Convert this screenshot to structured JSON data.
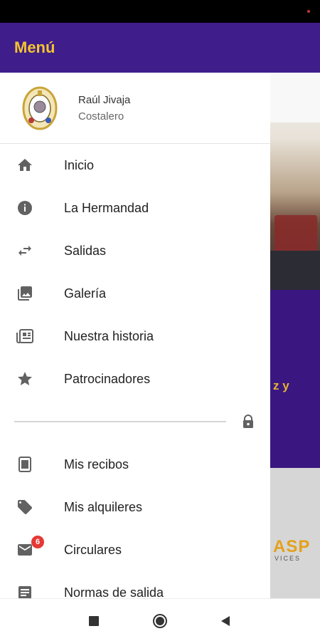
{
  "drawer": {
    "title": "Menú",
    "profile": {
      "name": "Raúl Jivaja",
      "role": "Costalero"
    },
    "items": [
      {
        "label": "Inicio",
        "icon": "home-icon"
      },
      {
        "label": "La Hermandad",
        "icon": "info-icon"
      },
      {
        "label": "Salidas",
        "icon": "swap-arrows-icon"
      },
      {
        "label": "Galería",
        "icon": "gallery-icon"
      },
      {
        "label": "Nuestra historia",
        "icon": "newspaper-icon"
      },
      {
        "label": "Patrocinadores",
        "icon": "star-icon"
      }
    ],
    "private_items": [
      {
        "label": "Mis recibos",
        "icon": "receipt-icon"
      },
      {
        "label": "Mis alquileres",
        "icon": "tag-icon"
      },
      {
        "label": "Circulares",
        "icon": "mail-icon",
        "badge": "6"
      },
      {
        "label": "Normas de salida",
        "icon": "document-icon"
      }
    ]
  },
  "background": {
    "gold_text": "z y",
    "sponsor_text": "ASP",
    "sponsor_sub": "VICES"
  },
  "colors": {
    "primary": "#3f1e8c",
    "accent": "#f4c430",
    "badge": "#e53935"
  }
}
